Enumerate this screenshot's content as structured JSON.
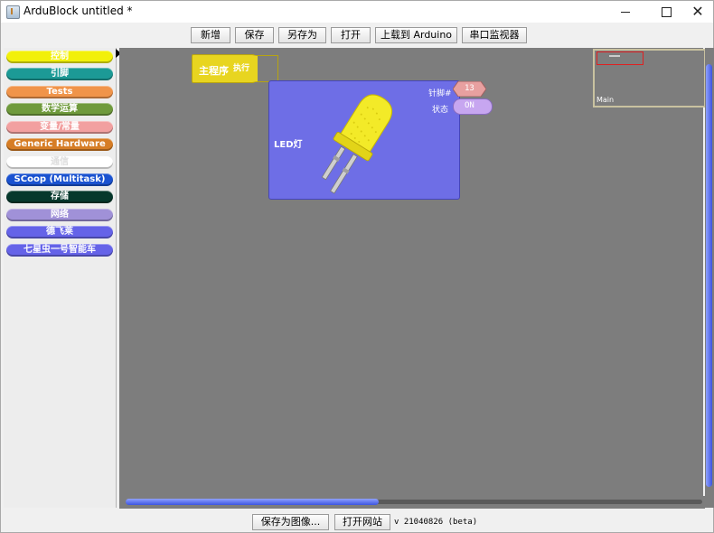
{
  "window": {
    "title": "ArduBlock untitled *"
  },
  "toolbar": {
    "new_label": "新增",
    "save_label": "保存",
    "save_as_label": "另存为",
    "open_label": "打开",
    "upload_label": "上载到 Arduino",
    "serial_monitor_label": "串口监视器"
  },
  "palette": {
    "categories": [
      {
        "label": "控制",
        "color": "#f2f00a"
      },
      {
        "label": "引脚",
        "color": "#1c9a96"
      },
      {
        "label": "Tests",
        "color": "#f0944a"
      },
      {
        "label": "数学运算",
        "color": "#6f9a3c"
      },
      {
        "label": "变量/常量",
        "color": "#f2a0a0"
      },
      {
        "label": "Generic Hardware",
        "color": "#d67d25"
      },
      {
        "label": "通信",
        "color": "#ffffff"
      },
      {
        "label": "SCoop (Multitask)",
        "color": "#1a52d0"
      },
      {
        "label": "存储",
        "color": "#06382c"
      },
      {
        "label": "网络",
        "color": "#a091d8"
      },
      {
        "label": "德飞莱",
        "color": "#6563e8"
      },
      {
        "label": "七星虫一号智能车",
        "color": "#6563e8"
      }
    ]
  },
  "canvas": {
    "main_block": {
      "label": "主程序",
      "exec_label": "执行",
      "color": "#e8d520"
    },
    "led_block": {
      "label": "LED灯",
      "pin_label": "针脚#",
      "pin_value": "13",
      "state_label": "状态",
      "state_value": "ON",
      "color": "#6e6ee6",
      "pin_socket_color": "#e8a0a0",
      "state_socket_color": "#c7a6f0"
    }
  },
  "minimap": {
    "label": "Main"
  },
  "statusbar": {
    "save_image_label": "保存为图像...",
    "open_website_label": "打开网站",
    "version": "v 21040826 (beta)"
  }
}
